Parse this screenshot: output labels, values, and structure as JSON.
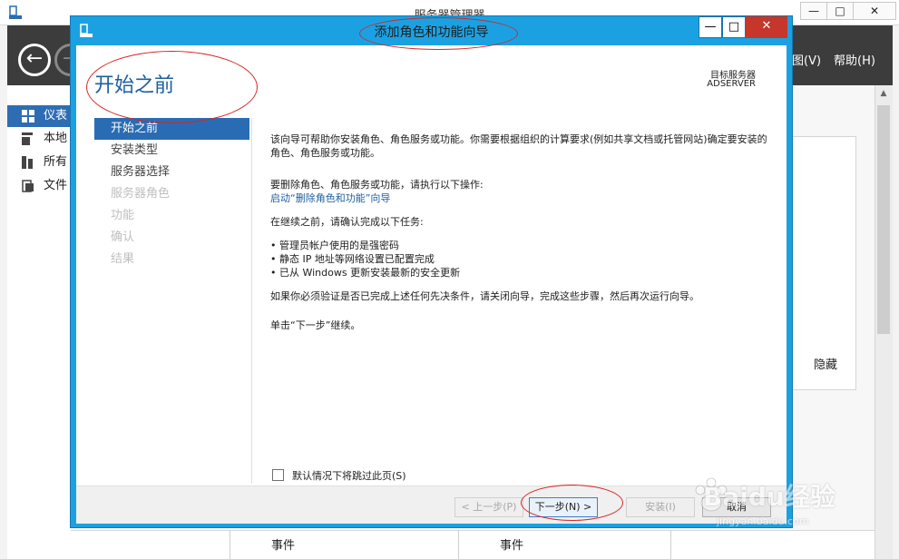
{
  "background": {
    "title": "服务器管理器",
    "window_controls": {
      "minimize": "—",
      "maximize": "□",
      "close": "✕"
    },
    "menu": {
      "view": "图(V)",
      "help": "帮助(H)"
    },
    "sidebar": [
      {
        "label": "仪表",
        "icon": "dashboard-icon",
        "active": true
      },
      {
        "label": "本地",
        "icon": "server-icon"
      },
      {
        "label": "所有",
        "icon": "servers-icon"
      },
      {
        "label": "文件",
        "icon": "file-storage-icon"
      }
    ],
    "hide_label": "隐藏",
    "events": [
      "事件",
      "事件"
    ]
  },
  "dialog": {
    "title": "添加角色和功能向导",
    "controls": {
      "minimize": "—",
      "maximize": "□",
      "close": "✕"
    },
    "heading": "开始之前",
    "target_label": "目标服务器",
    "target_value": "ADSERVER",
    "steps": [
      {
        "label": "开始之前",
        "state": "active"
      },
      {
        "label": "安装类型",
        "state": "normal"
      },
      {
        "label": "服务器选择",
        "state": "normal"
      },
      {
        "label": "服务器角色",
        "state": "disabled"
      },
      {
        "label": "功能",
        "state": "disabled"
      },
      {
        "label": "确认",
        "state": "disabled"
      },
      {
        "label": "结果",
        "state": "disabled"
      }
    ],
    "intro": "该向导可帮助你安装角色、角色服务或功能。你需要根据组织的计算要求(例如共享文档或托管网站)确定要安装的角色、角色服务或功能。",
    "remove_text": "要删除角色、角色服务或功能，请执行以下操作:",
    "remove_link": "启动“删除角色和功能”向导",
    "before_text": "在继续之前，请确认完成以下任务:",
    "bullets": [
      "• 管理员帐户使用的是强密码",
      "• 静态 IP 地址等网络设置已配置完成",
      "• 已从 Windows 更新安装最新的安全更新"
    ],
    "prereq_text": "如果你必须验证是否已完成上述任何先决条件，请关闭向导，完成这些步骤，然后再次运行向导。",
    "continue_text": "单击“下一步”继续。",
    "skip_label": "默认情况下将跳过此页(S)",
    "buttons": {
      "prev": "< 上一步(P)",
      "next": "下一步(N) >",
      "install": "安装(I)",
      "cancel": "取消"
    }
  },
  "watermark": {
    "text": "Baidu经验",
    "url": "jingyan.baidu.com"
  }
}
